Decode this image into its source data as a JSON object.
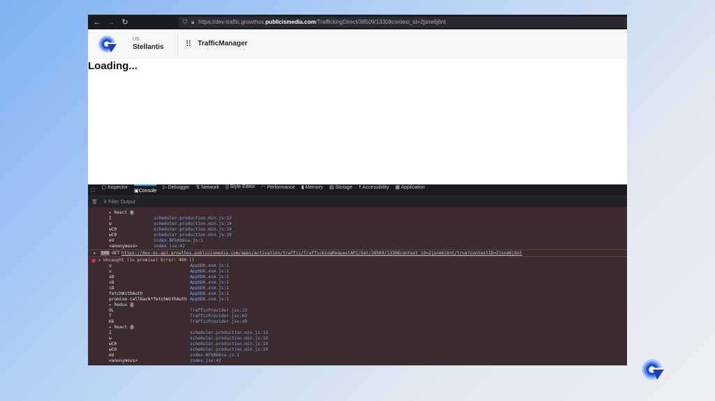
{
  "browser": {
    "url_prefix": "https://dev-traffic.growthos.",
    "url_domain": "publicismedia.com",
    "url_path": "/TraffickingDirect/38509/13308context_id=2jsne6j6nt"
  },
  "header": {
    "country": "US",
    "org": "Stellantis",
    "app": "TrafficManager"
  },
  "page": {
    "loading": "Loading..."
  },
  "devtools": {
    "tabs": [
      "Inspector",
      "Console",
      "Debugger",
      "Network",
      "Style Editor",
      "Performance",
      "Memory",
      "Storage",
      "Accessibility",
      "Application"
    ],
    "active_tab": "Console",
    "filter_placeholder": "Filter Output"
  },
  "console": {
    "stack1": [
      {
        "g": "React",
        "count": "6"
      },
      {
        "f": "I",
        "s": "scheduler.production.min.js:13"
      },
      {
        "f": "w",
        "s": "scheduler.production.min.js:14"
      },
      {
        "f": "wC0",
        "s": "scheduler.production.min.js:14"
      },
      {
        "f": "wC0",
        "s": "scheduler.production.min.js:19"
      },
      {
        "f": "eV",
        "s": "index-BFkK66va.js:1"
      },
      {
        "f": "<anonymous>",
        "s": "index.jsx:42"
      }
    ],
    "xhr": {
      "badge": "XHR",
      "method": "GET",
      "url": "https://dev-os-api.growthos.publicismedia.com/apps/activation/traffic/TraffickingRequestAPI/Get/38509/13308context_id=2jsne6j6nt/true?contextID=2jsne6j6nt"
    },
    "error": "Uncaught (in promise) Error: 400 ()",
    "stack2": [
      {
        "f": "u",
        "s": "AppSDK.esm.js:1"
      },
      {
        "f": "u",
        "s": "AppSDK.esm.js:1"
      },
      {
        "f": "sD",
        "s": "AppSDK.esm.js:1"
      },
      {
        "f": "cD",
        "s": "AppSDK.esm.js:1"
      },
      {
        "f": "cD",
        "s": "AppSDK.esm.js:1"
      },
      {
        "f": "fetchWithAuth",
        "s": "AppSDK.esm.js:1"
      },
      {
        "f": "promise callback*fetchWithAuth",
        "s": "AppSDK.esm.js:1"
      },
      {
        "g": "Redux",
        "count": "2"
      },
      {
        "f": "OL",
        "s": "TrafficProvider.jsx:23"
      },
      {
        "f": "T",
        "s": "TrafficProvider.jsx:63"
      },
      {
        "f": "Kk",
        "s": "TrafficProvider.jsx:49"
      },
      {
        "g": "React",
        "count": "3"
      },
      {
        "f": "I",
        "s": "scheduler.production.min.js:13"
      },
      {
        "f": "w",
        "s": "scheduler.production.min.js:14"
      },
      {
        "f": "wC0",
        "s": "scheduler.production.min.js:14"
      },
      {
        "f": "wC0",
        "s": "scheduler.production.min.js:19"
      },
      {
        "f": "eV",
        "s": "index-BFkK66va.js:1"
      },
      {
        "f": "<anonymous>",
        "s": "index.jsx:42"
      }
    ]
  },
  "colors": {
    "brand": "#1f4fd8",
    "console_bg": "#3b2a2e",
    "link": "#7fa7e8"
  }
}
